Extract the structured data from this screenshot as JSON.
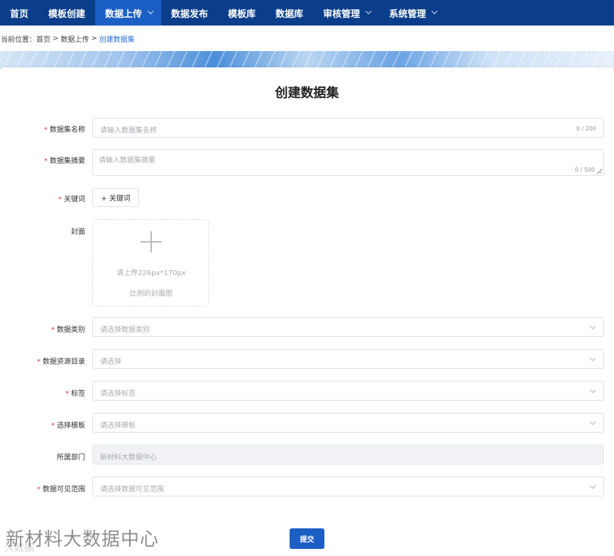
{
  "nav": {
    "items": [
      {
        "label": "首页",
        "dropdown": false,
        "active": false
      },
      {
        "label": "模板创建",
        "dropdown": false,
        "active": false
      },
      {
        "label": "数据上传",
        "dropdown": true,
        "active": true
      },
      {
        "label": "数据发布",
        "dropdown": false,
        "active": false
      },
      {
        "label": "模板库",
        "dropdown": false,
        "active": false
      },
      {
        "label": "数据库",
        "dropdown": false,
        "active": false
      },
      {
        "label": "审核管理",
        "dropdown": true,
        "active": false
      },
      {
        "label": "系统管理",
        "dropdown": true,
        "active": false
      }
    ]
  },
  "breadcrumb": {
    "prefix": "当前位置：",
    "home": "首页",
    "separator": ">",
    "section": "数据上传",
    "current": "创建数据集"
  },
  "form": {
    "title": "创建数据集",
    "name": {
      "label": "数据集名称",
      "required": true,
      "placeholder": "请输入数据集名称",
      "count": "0 / 200"
    },
    "summary": {
      "label": "数据集摘要",
      "required": true,
      "placeholder": "请输入数据集摘要",
      "count": "0 / 500"
    },
    "keywords": {
      "label": "关键词",
      "required": true,
      "button": "+ 关键词"
    },
    "cover": {
      "label": "封面",
      "hint1": "请上传226px*170px",
      "hint2": "比例的封面图"
    },
    "category": {
      "label": "数据类别",
      "required": true,
      "placeholder": "请选择数据类别"
    },
    "catalog": {
      "label": "数据资源目录",
      "required": true,
      "placeholder": "请选择"
    },
    "tags": {
      "label": "标签",
      "required": true,
      "placeholder": "请选择标签"
    },
    "template": {
      "label": "选择模板",
      "required": true,
      "placeholder": "请选择模板"
    },
    "department": {
      "label": "所属部门",
      "value": "新材料大数据中心"
    },
    "visibility": {
      "label": "数据可见范围",
      "required": true,
      "placeholder": "请选择数据可见范围"
    },
    "submit": "提交"
  },
  "watermark": {
    "text": "新材料大数据中心",
    "sub": "大数据"
  },
  "colors": {
    "nav_bg": "#0b3e8a",
    "nav_active": "#1c5fc4",
    "accent": "#2a6fd6",
    "required": "#e4393c"
  }
}
